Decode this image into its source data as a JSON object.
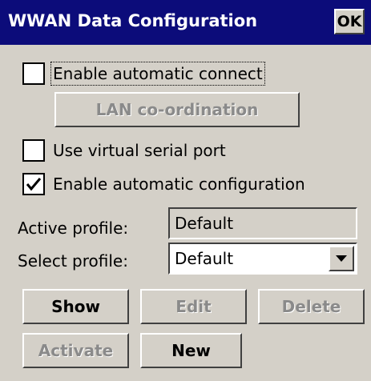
{
  "window": {
    "title": "WWAN Data Configuration",
    "ok_label": "OK"
  },
  "options": {
    "auto_connect": {
      "label": "Enable automatic connect",
      "checked": false
    },
    "lan_button": "LAN co-ordination",
    "virtual_serial": {
      "label": "Use virtual serial port",
      "checked": false
    },
    "auto_config": {
      "label": "Enable automatic configuration",
      "checked": true
    }
  },
  "profile": {
    "active_label": "Active profile:",
    "active_value": "Default",
    "select_label": "Select profile:",
    "select_value": "Default"
  },
  "buttons": {
    "show": "Show",
    "edit": "Edit",
    "delete": "Delete",
    "activate": "Activate",
    "new": "New"
  },
  "icons": {
    "checkbox_check": "checkmark-icon",
    "dropdown": "chevron-down-icon"
  },
  "colors": {
    "titlebar": "#0c0c7a",
    "dialog_bg": "#d4d0c8"
  }
}
